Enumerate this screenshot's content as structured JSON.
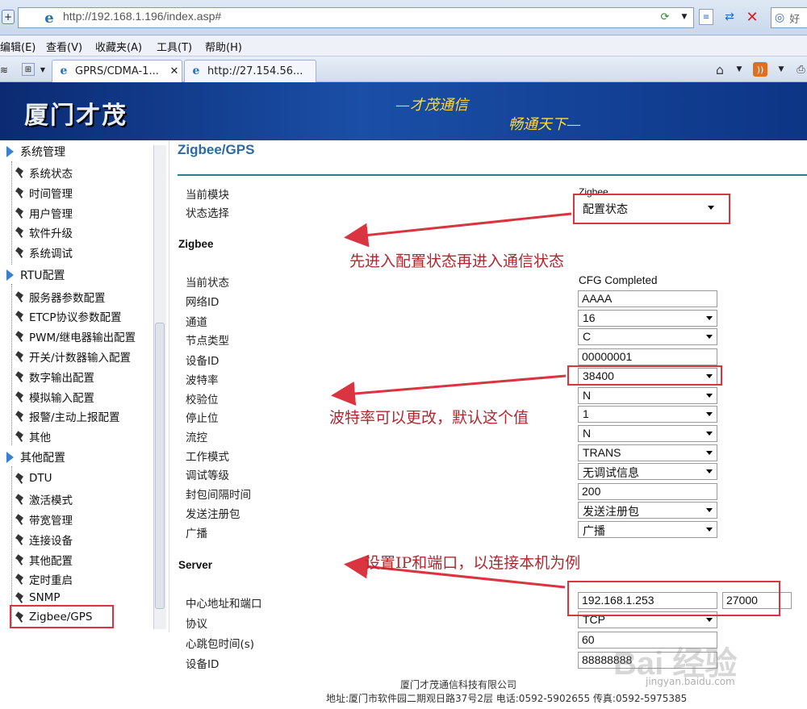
{
  "browser": {
    "url": "http://192.168.1.196/index.asp#",
    "search_placeholder": "好",
    "menus": [
      "编辑(E)",
      "查看(V)",
      "收藏夹(A)",
      "工具(T)",
      "帮助(H)"
    ],
    "tabs": [
      "GPRS/CDMA-1...",
      "http://27.154.56..."
    ]
  },
  "banner": {
    "logo": "厦门才茂",
    "slogan_line1": "—才茂通信",
    "slogan_line2": "畅通天下—"
  },
  "sidebar": {
    "groups": [
      {
        "label": "系统管理",
        "items": [
          "系统状态",
          "时间管理",
          "用户管理",
          "软件升级",
          "系统调试"
        ]
      },
      {
        "label": "RTU配置",
        "items": [
          "服务器参数配置",
          "ETCP协议参数配置",
          "PWM/继电器输出配置",
          "开关/计数器输入配置",
          "数字输出配置",
          "模拟输入配置",
          "报警/主动上报配置",
          "其他"
        ]
      },
      {
        "label": "其他配置",
        "items": [
          "DTU",
          "激活模式",
          "带宽管理",
          "连接设备",
          "其他配置",
          "定时重启",
          "SNMP",
          "Zigbee/GPS"
        ]
      }
    ]
  },
  "content": {
    "title": "Zigbee/GPS",
    "current_module_label": "当前模块",
    "current_module_value": "Zigbee",
    "state_select_label": "状态选择",
    "state_select_value": "配置状态",
    "zigbee_section": "Zigbee",
    "current_state_label": "当前状态",
    "current_state_value": "CFG Completed",
    "fields": {
      "net_id": {
        "label": "网络ID",
        "value": "AAAA"
      },
      "channel": {
        "label": "通道",
        "value": "16"
      },
      "node_type": {
        "label": "节点类型",
        "value": "C"
      },
      "device_id": {
        "label": "设备ID",
        "value": "00000001"
      },
      "baud_rate": {
        "label": "波特率",
        "value": "38400"
      },
      "parity": {
        "label": "校验位",
        "value": "N"
      },
      "stop_bit": {
        "label": "停止位",
        "value": "1"
      },
      "flow_control": {
        "label": "流控",
        "value": "N"
      },
      "work_mode": {
        "label": "工作模式",
        "value": "TRANS"
      },
      "debug_level": {
        "label": "调试等级",
        "value": "无调试信息"
      },
      "pack_interval": {
        "label": "封包间隔时间",
        "value": "200"
      },
      "send_register": {
        "label": "发送注册包",
        "value": "发送注册包"
      },
      "broadcast": {
        "label": "广播",
        "value": "广播"
      }
    },
    "server_section": "Server",
    "server": {
      "center_addr_label": "中心地址和端口",
      "center_ip": "192.168.1.253",
      "center_port": "27000",
      "protocol_label": "协议",
      "protocol_value": "TCP",
      "heartbeat_label": "心跳包时间(s)",
      "heartbeat_value": "60",
      "device_id_label": "设备ID",
      "device_id_value": "88888888"
    }
  },
  "annotations": {
    "note1": "先进入配置状态再进入通信状态",
    "note2": "波特率可以更改，默认这个值",
    "note3": "设置IP和端口，以连接本机为例",
    "color": "#d9343f"
  },
  "footer": {
    "line1": "厦门才茂通信科技有限公司",
    "line2": "地址:厦门市软件园二期观日路37号2层 电话:0592-5902655 传真:0592-5975385"
  },
  "watermark": {
    "text": "Bai 经验",
    "url": "jingyan.baidu.com"
  }
}
